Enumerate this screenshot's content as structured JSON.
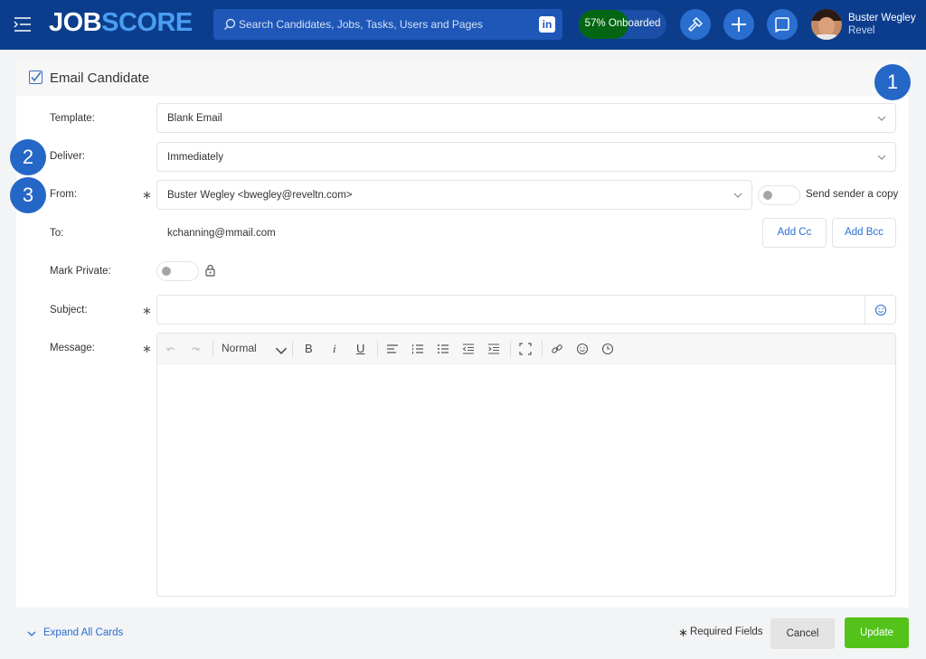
{
  "header": {
    "logo_part1": "JOB",
    "logo_part2": "SCORE",
    "search_placeholder": "Search Candidates, Jobs, Tasks, Users and Pages",
    "linkedin_label": "in",
    "onboarded_label": "57% Onboarded",
    "onboarded_percent": 57,
    "user_name": "Buster Wegley",
    "user_company": "Revel"
  },
  "card": {
    "title": "Email Candidate",
    "template": {
      "label": "Template:",
      "value": "Blank Email"
    },
    "deliver": {
      "label": "Deliver:",
      "value": "Immediately"
    },
    "from": {
      "label": "From:",
      "value": "Buster Wegley <bwegley@reveltn.com>",
      "send_copy_label": "Send sender a copy",
      "send_copy_on": false
    },
    "to": {
      "label": "To:",
      "value": "kchanning@mmail.com",
      "add_cc": "Add Cc",
      "add_bcc": "Add Bcc"
    },
    "mark_private": {
      "label": "Mark Private:",
      "on": false
    },
    "subject": {
      "label": "Subject:",
      "value": ""
    },
    "message": {
      "label": "Message:",
      "format_value": "Normal",
      "bold": "B",
      "italic": "i",
      "underline": "U"
    },
    "required_marker": "∗"
  },
  "steps": [
    "1",
    "2",
    "3"
  ],
  "footer": {
    "expand_label": "Expand All Cards",
    "required_star": "∗",
    "required_note": "Required Fields",
    "cancel": "Cancel",
    "update": "Update"
  },
  "colors": {
    "topbar": "#0c3d8d",
    "accent": "#2a6fd0",
    "onboard_fill": "#046612",
    "update_button": "#53c31b",
    "step_badge": "#2467c7"
  }
}
